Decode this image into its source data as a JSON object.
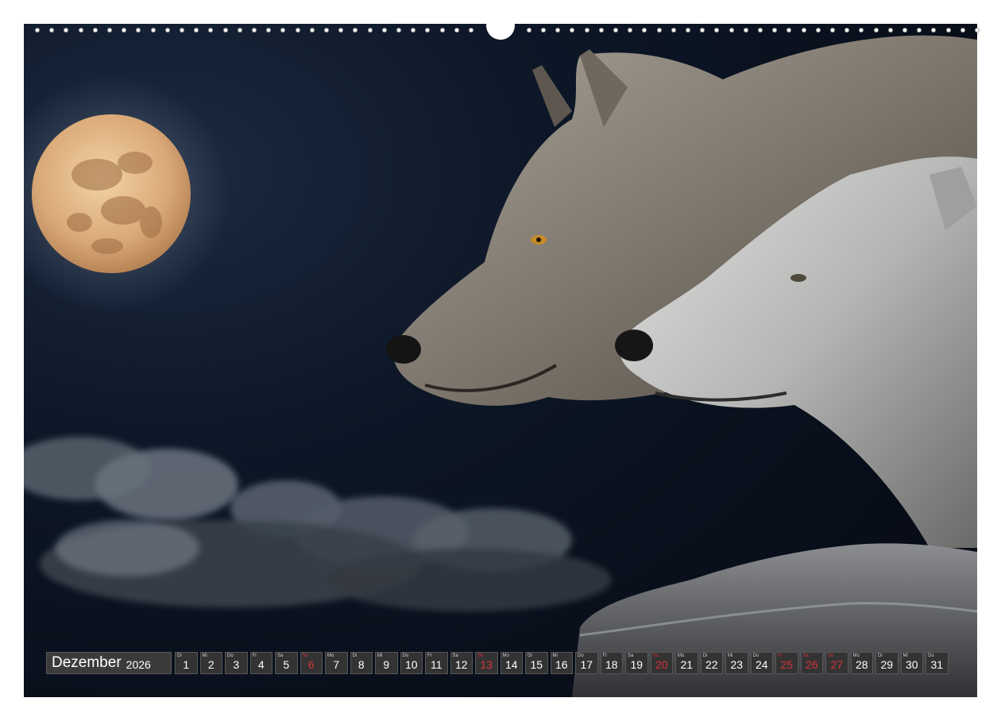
{
  "calendar": {
    "month": "Dezember",
    "year": "2026",
    "days": [
      {
        "wd": "Di",
        "num": "1",
        "sunday": false
      },
      {
        "wd": "Mi",
        "num": "2",
        "sunday": false
      },
      {
        "wd": "Do",
        "num": "3",
        "sunday": false
      },
      {
        "wd": "Fr",
        "num": "4",
        "sunday": false
      },
      {
        "wd": "Sa",
        "num": "5",
        "sunday": false
      },
      {
        "wd": "So",
        "num": "6",
        "sunday": true
      },
      {
        "wd": "Mo",
        "num": "7",
        "sunday": false
      },
      {
        "wd": "Di",
        "num": "8",
        "sunday": false
      },
      {
        "wd": "Mi",
        "num": "9",
        "sunday": false
      },
      {
        "wd": "Do",
        "num": "10",
        "sunday": false
      },
      {
        "wd": "Fr",
        "num": "11",
        "sunday": false
      },
      {
        "wd": "Sa",
        "num": "12",
        "sunday": false
      },
      {
        "wd": "So",
        "num": "13",
        "sunday": true
      },
      {
        "wd": "Mo",
        "num": "14",
        "sunday": false
      },
      {
        "wd": "Di",
        "num": "15",
        "sunday": false
      },
      {
        "wd": "Mi",
        "num": "16",
        "sunday": false
      },
      {
        "wd": "Do",
        "num": "17",
        "sunday": false
      },
      {
        "wd": "Fr",
        "num": "18",
        "sunday": false
      },
      {
        "wd": "Sa",
        "num": "19",
        "sunday": false
      },
      {
        "wd": "So",
        "num": "20",
        "sunday": true
      },
      {
        "wd": "Mo",
        "num": "21",
        "sunday": false
      },
      {
        "wd": "Di",
        "num": "22",
        "sunday": false
      },
      {
        "wd": "Mi",
        "num": "23",
        "sunday": false
      },
      {
        "wd": "Do",
        "num": "24",
        "sunday": false
      },
      {
        "wd": "Fr",
        "num": "25",
        "sunday": true
      },
      {
        "wd": "Sa",
        "num": "26",
        "sunday": true
      },
      {
        "wd": "So",
        "num": "27",
        "sunday": true
      },
      {
        "wd": "Mo",
        "num": "28",
        "sunday": false
      },
      {
        "wd": "Di",
        "num": "29",
        "sunday": false
      },
      {
        "wd": "Mi",
        "num": "30",
        "sunday": false
      },
      {
        "wd": "Do",
        "num": "31",
        "sunday": false
      }
    ]
  },
  "colors": {
    "sky": "#0b1422",
    "moon": "#e9c597",
    "wolf_dark": "#8a8378",
    "wolf_light": "#c9c9c6",
    "holiday_red": "#d7333c",
    "strip_bg": "#333333"
  }
}
